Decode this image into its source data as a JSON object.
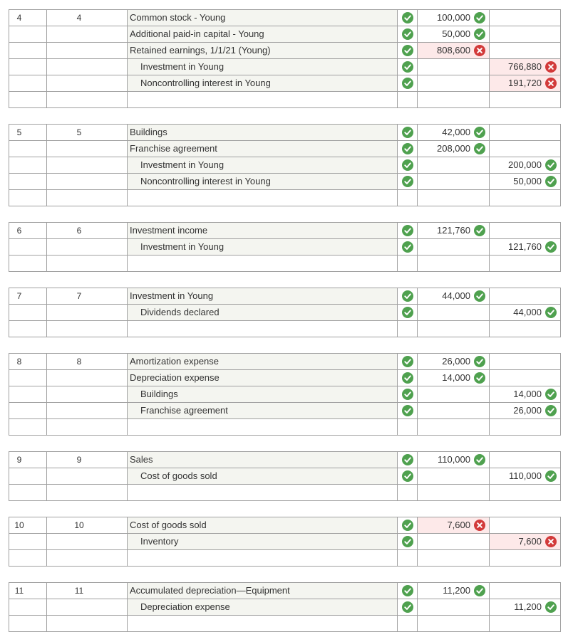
{
  "colors": {
    "grid": "#a0a0a0",
    "row_shade": "#f4f5f0",
    "error_fill": "#fde9e9",
    "check": "#4fa14f",
    "error": "#d23a3a"
  },
  "icons": {
    "correct": "check-circle-icon",
    "incorrect": "x-circle-icon"
  },
  "entries": [
    {
      "no": "4",
      "no2": "4",
      "lines": [
        {
          "account": "Common stock - Young",
          "indent": false,
          "debit": "100,000",
          "debit_ok": true,
          "credit": "",
          "credit_ok": null
        },
        {
          "account": "Additional paid-in capital - Young",
          "indent": false,
          "debit": "50,000",
          "debit_ok": true,
          "credit": "",
          "credit_ok": null
        },
        {
          "account": "Retained earnings, 1/1/21 (Young)",
          "indent": false,
          "debit": "808,600",
          "debit_ok": false,
          "credit": "",
          "credit_ok": null
        },
        {
          "account": "Investment in Young",
          "indent": true,
          "debit": "",
          "debit_ok": null,
          "credit": "766,880",
          "credit_ok": false
        },
        {
          "account": "Noncontrolling interest in Young",
          "indent": true,
          "debit": "",
          "debit_ok": null,
          "credit": "191,720",
          "credit_ok": false
        }
      ]
    },
    {
      "no": "5",
      "no2": "5",
      "lines": [
        {
          "account": "Buildings",
          "indent": false,
          "debit": "42,000",
          "debit_ok": true,
          "credit": "",
          "credit_ok": null
        },
        {
          "account": "Franchise agreement",
          "indent": false,
          "debit": "208,000",
          "debit_ok": true,
          "credit": "",
          "credit_ok": null
        },
        {
          "account": "Investment in Young",
          "indent": true,
          "debit": "",
          "debit_ok": null,
          "credit": "200,000",
          "credit_ok": true
        },
        {
          "account": "Noncontrolling interest in Young",
          "indent": true,
          "debit": "",
          "debit_ok": null,
          "credit": "50,000",
          "credit_ok": true
        }
      ]
    },
    {
      "no": "6",
      "no2": "6",
      "lines": [
        {
          "account": "Investment income",
          "indent": false,
          "debit": "121,760",
          "debit_ok": true,
          "credit": "",
          "credit_ok": null
        },
        {
          "account": "Investment in Young",
          "indent": true,
          "debit": "",
          "debit_ok": null,
          "credit": "121,760",
          "credit_ok": true
        }
      ]
    },
    {
      "no": "7",
      "no2": "7",
      "lines": [
        {
          "account": "Investment in Young",
          "indent": false,
          "debit": "44,000",
          "debit_ok": true,
          "credit": "",
          "credit_ok": null
        },
        {
          "account": "Dividends declared",
          "indent": true,
          "debit": "",
          "debit_ok": null,
          "credit": "44,000",
          "credit_ok": true
        }
      ]
    },
    {
      "no": "8",
      "no2": "8",
      "lines": [
        {
          "account": "Amortization expense",
          "indent": false,
          "debit": "26,000",
          "debit_ok": true,
          "credit": "",
          "credit_ok": null
        },
        {
          "account": "Depreciation expense",
          "indent": false,
          "debit": "14,000",
          "debit_ok": true,
          "credit": "",
          "credit_ok": null
        },
        {
          "account": "Buildings",
          "indent": true,
          "debit": "",
          "debit_ok": null,
          "credit": "14,000",
          "credit_ok": true
        },
        {
          "account": "Franchise agreement",
          "indent": true,
          "debit": "",
          "debit_ok": null,
          "credit": "26,000",
          "credit_ok": true
        }
      ]
    },
    {
      "no": "9",
      "no2": "9",
      "lines": [
        {
          "account": "Sales",
          "indent": false,
          "debit": "110,000",
          "debit_ok": true,
          "credit": "",
          "credit_ok": null
        },
        {
          "account": "Cost of goods sold",
          "indent": true,
          "debit": "",
          "debit_ok": null,
          "credit": "110,000",
          "credit_ok": true
        }
      ]
    },
    {
      "no": "10",
      "no2": "10",
      "lines": [
        {
          "account": "Cost of goods sold",
          "indent": false,
          "debit": "7,600",
          "debit_ok": false,
          "credit": "",
          "credit_ok": null
        },
        {
          "account": "Inventory",
          "indent": true,
          "debit": "",
          "debit_ok": null,
          "credit": "7,600",
          "credit_ok": false
        }
      ]
    },
    {
      "no": "11",
      "no2": "11",
      "lines": [
        {
          "account": "Accumulated depreciation—Equipment",
          "indent": false,
          "debit": "11,200",
          "debit_ok": true,
          "credit": "",
          "credit_ok": null
        },
        {
          "account": "Depreciation expense",
          "indent": true,
          "debit": "",
          "debit_ok": null,
          "credit": "11,200",
          "credit_ok": true
        }
      ]
    }
  ]
}
